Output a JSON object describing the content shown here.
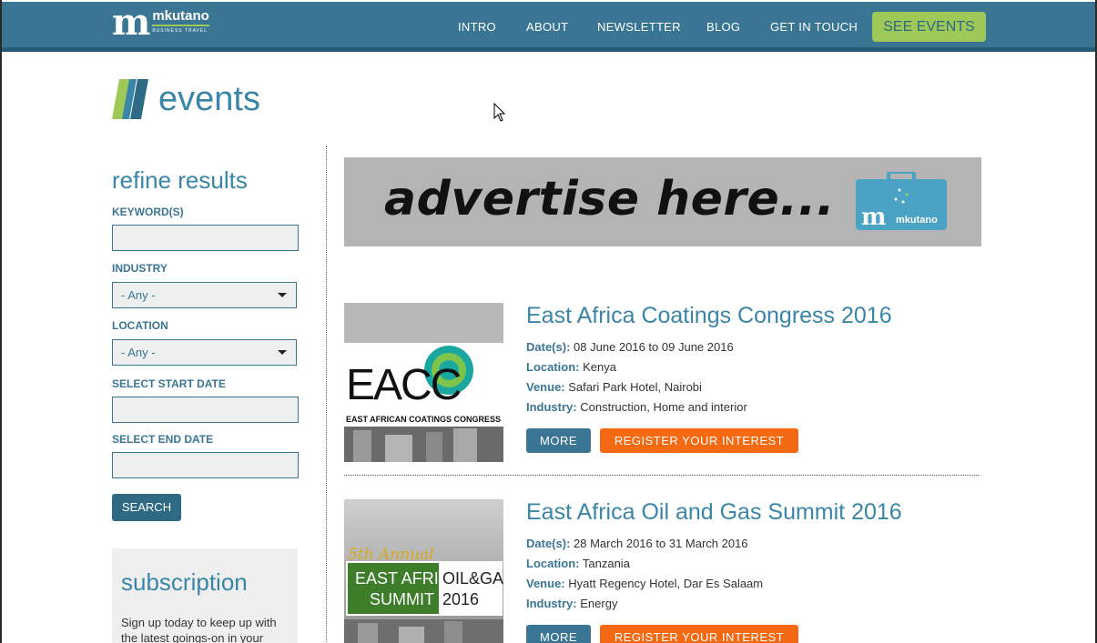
{
  "brand": {
    "mark": "m",
    "name": "mkutano",
    "tagline": "BUSINESS TRAVEL"
  },
  "nav": {
    "items": [
      {
        "label": "INTRO"
      },
      {
        "label": "ABOUT"
      },
      {
        "label": "NEWSLETTER"
      },
      {
        "label": "BLOG"
      },
      {
        "label": "GET IN TOUCH"
      }
    ],
    "cta": "SEE EVENTS"
  },
  "page": {
    "title": "events"
  },
  "sidebar": {
    "heading": "refine results",
    "keyword_label": "KEYWORD(S)",
    "keyword_value": "",
    "industry_label": "INDUSTRY",
    "industry_value": "- Any -",
    "location_label": "LOCATION",
    "location_value": "- Any -",
    "start_label": "SELECT START DATE",
    "start_value": "",
    "end_label": "SELECT END DATE",
    "end_value": "",
    "search_label": "SEARCH"
  },
  "subscription": {
    "heading": "subscription",
    "text": "Sign up today to keep up with the latest goings-on in your"
  },
  "ad": {
    "text": "advertise here...",
    "logo_mark": "m",
    "logo_name": "mkutano"
  },
  "events": [
    {
      "title": "East Africa Coatings Congress 2016",
      "dates_label": "Date(s):",
      "dates": "08 June 2016 to 09 June 2016",
      "location_label": "Location:",
      "location": "Kenya",
      "venue_label": "Venue:",
      "venue": "Safari Park Hotel, Nairobi",
      "industry_label": "Industry:",
      "industry": "Construction, Home and interior",
      "more_label": "MORE",
      "register_label": "REGISTER YOUR INTEREST",
      "thumb": {
        "logo": "EACC",
        "caption": "EAST AFRICAN COATINGS CONGRESS"
      }
    },
    {
      "title": "East Africa Oil and Gas Summit 2016",
      "dates_label": "Date(s):",
      "dates": "28 March 2016 to 31 March 2016",
      "location_label": "Location:",
      "location": "Tanzania",
      "venue_label": "Venue:",
      "venue": "Hyatt Regency Hotel, Dar Es Salaam",
      "industry_label": "Industry:",
      "industry": "Energy",
      "more_label": "MORE",
      "register_label": "REGISTER YOUR INTEREST",
      "thumb": {
        "annual": "5th Annual",
        "line1": "EAST AFRICA",
        "line2": "SUMMIT",
        "line3": "OIL&GAS",
        "line4": "2016"
      }
    }
  ],
  "colors": {
    "header": "#3a7694",
    "accent_green": "#9ec857",
    "accent_orange": "#f46a12",
    "heading_blue": "#3a86a8"
  }
}
